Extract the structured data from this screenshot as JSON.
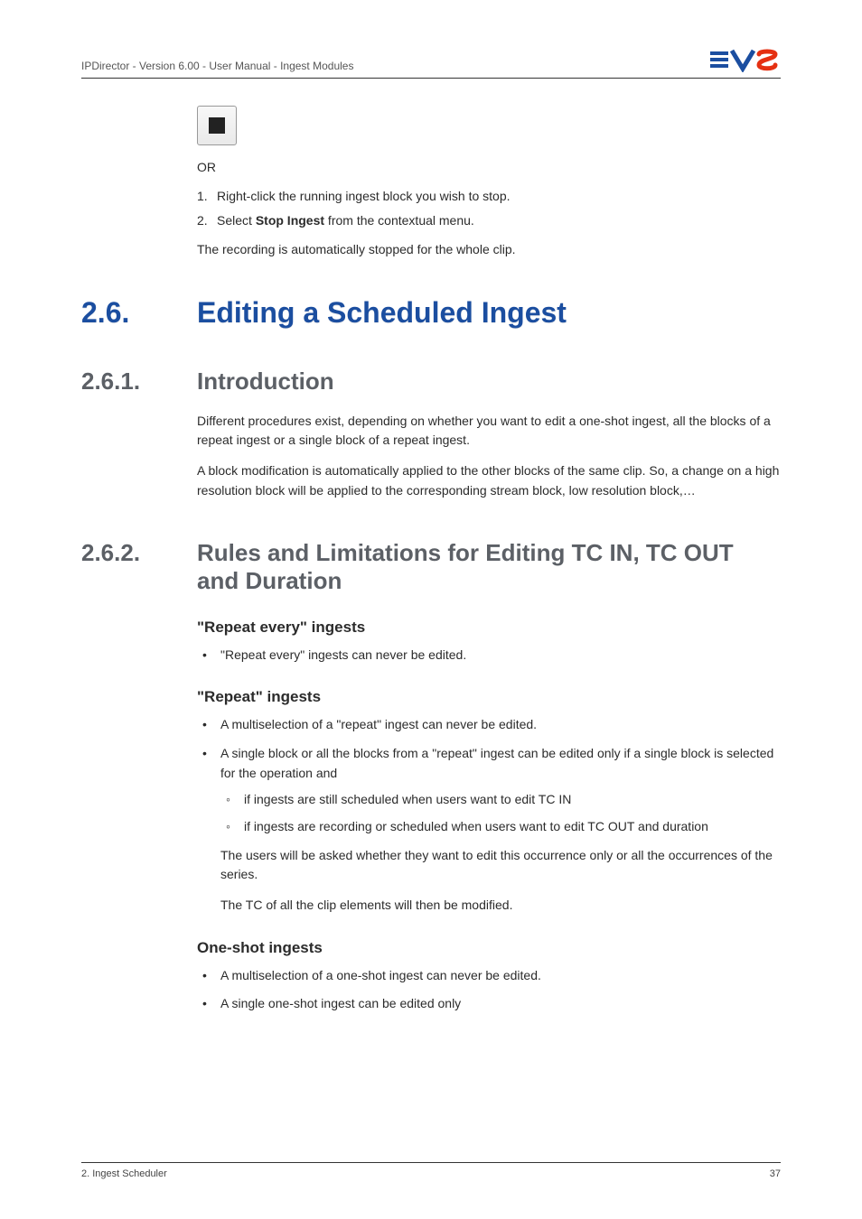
{
  "header": {
    "left": "IPDirector - Version 6.00 - User Manual - Ingest Modules"
  },
  "top": {
    "or": "OR",
    "step1_num": "1.",
    "step1_text": "Right-click the running ingest block you wish to stop.",
    "step2_num": "2.",
    "step2_pre": "Select ",
    "step2_bold": "Stop Ingest",
    "step2_post": " from the contextual menu.",
    "after": "The recording is automatically stopped for the whole clip."
  },
  "sec": {
    "num": "2.6.",
    "title": "Editing a Scheduled Ingest"
  },
  "sub1": {
    "num": "2.6.1.",
    "title": "Introduction",
    "p1": "Different procedures exist, depending on whether you want to edit a one-shot ingest, all the blocks of a repeat ingest or a single block of a repeat ingest.",
    "p2": "A block modification is automatically applied to the other blocks of the same clip. So, a change on a high resolution block will be applied to the corresponding stream block, low resolution block,…"
  },
  "sub2": {
    "num": "2.6.2.",
    "title": "Rules and Limitations for Editing TC IN, TC OUT and Duration",
    "h3a": "\"Repeat every\" ingests",
    "a1": "\"Repeat every\" ingests can never be edited.",
    "h3b": "\"Repeat\" ingests",
    "b1": "A multiselection of a \"repeat\" ingest can never be edited.",
    "b2": "A single block or all the blocks from a \"repeat\" ingest can be edited only if a single block is selected for the operation and",
    "b2s1": "if ingests are still scheduled when users want to edit TC IN",
    "b2s2": "if ingests are recording or scheduled when users want to edit TC OUT and duration",
    "b_p1": "The users will be asked whether they want to edit this occurrence only or all the occurrences of the series.",
    "b_p2": "The TC of all the clip elements will then be modified.",
    "h3c": "One-shot ingests",
    "c1": "A multiselection of a one-shot ingest can never be edited.",
    "c2": "A single one-shot ingest can be edited only"
  },
  "footer": {
    "left": "2. Ingest Scheduler",
    "right": "37"
  }
}
